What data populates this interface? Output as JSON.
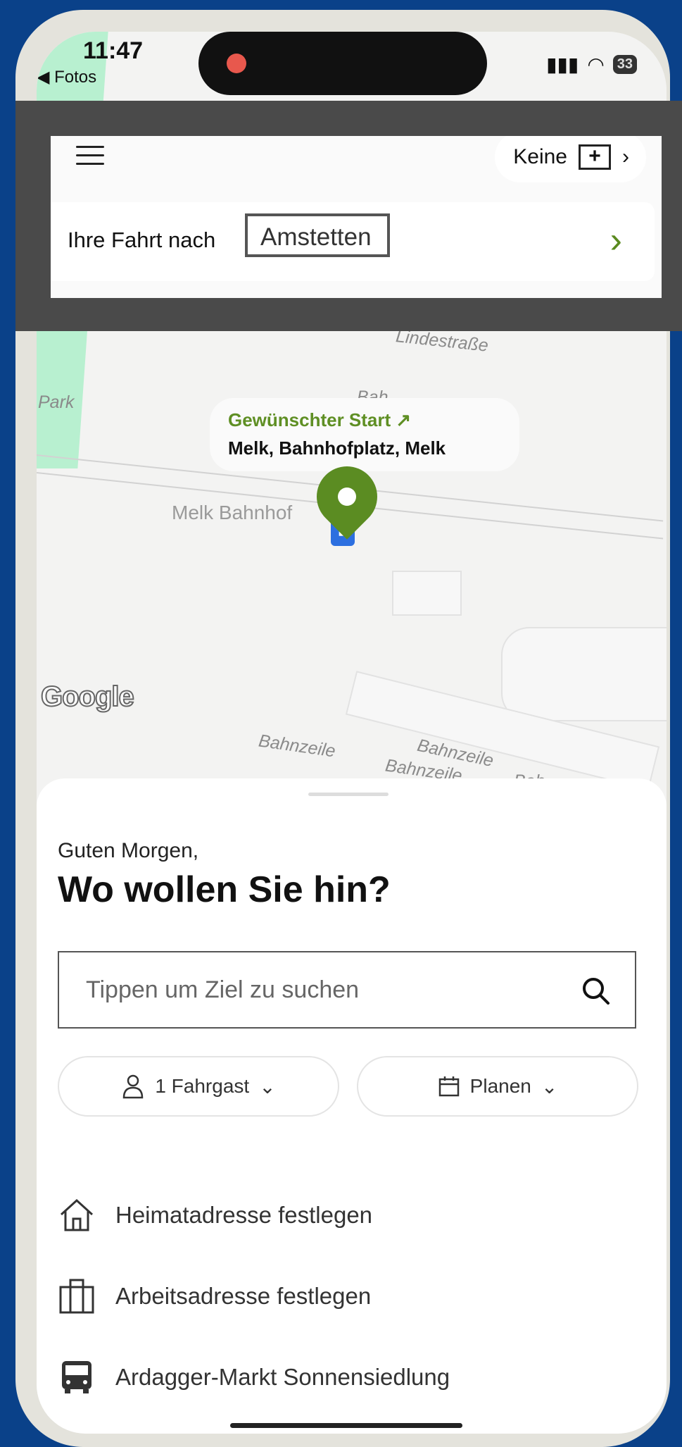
{
  "status_bar": {
    "time": "11:47",
    "back_app": "Fotos",
    "battery": "33"
  },
  "top": {
    "profile_label": "Keine",
    "trip_label": "Ihre Fahrt nach",
    "trip_destination": "Amstetten"
  },
  "map": {
    "street_top": "Lindestraße",
    "park_label": "Park",
    "street_bah": "Bah",
    "station_label": "Melk Bahnhof",
    "street_bottom_1": "Bahnzeile",
    "street_bottom_2": "Bahnzeile",
    "street_bottom_3": "Bahnzeile",
    "street_bottom_4": "Bah",
    "provider": "Google",
    "start_title": "Gewünschter Start ↗",
    "start_address": "Melk, Bahnhofplatz, Melk"
  },
  "sheet": {
    "greeting": "Guten Morgen,",
    "headline": "Wo wollen Sie hin?",
    "search_placeholder": "Tippen um Ziel zu suchen",
    "passengers": "1 Fahrgast",
    "plan": "Planen",
    "items": [
      {
        "label": "Heimatadresse festlegen",
        "icon": "home-icon"
      },
      {
        "label": "Arbeitsadresse festlegen",
        "icon": "briefcase-icon"
      },
      {
        "label": "Ardagger-Markt Sonnensiedlung",
        "icon": "bus-icon"
      }
    ]
  },
  "colors": {
    "accent_green": "#5b8c22",
    "frame_blue": "#0a4189"
  }
}
